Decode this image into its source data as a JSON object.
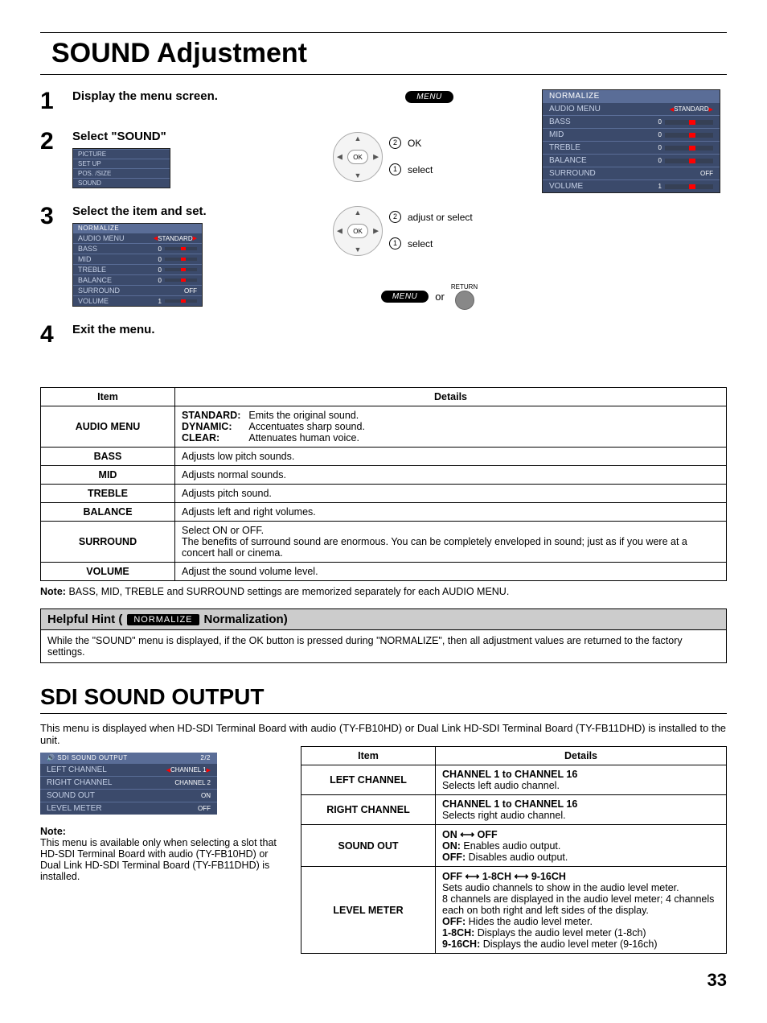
{
  "page": {
    "title": "SOUND Adjustment",
    "page_number": "33"
  },
  "steps": [
    {
      "num": "1",
      "title": "Display the menu screen."
    },
    {
      "num": "2",
      "title": "Select \"SOUND\""
    },
    {
      "num": "3",
      "title": "Select the item and set."
    },
    {
      "num": "4",
      "title": "Exit the menu."
    }
  ],
  "remote": {
    "menu_label": "MENU",
    "return_label": "RETURN",
    "ok_label": "OK",
    "or": "or",
    "labels": {
      "ok_action": "OK",
      "select": "select",
      "adjust": "adjust or select"
    }
  },
  "osd_small_menu": {
    "items": [
      "PICTURE",
      "SET UP",
      "POS. /SIZE",
      "SOUND"
    ]
  },
  "osd_sound": {
    "head": "NORMALIZE",
    "rows": [
      {
        "k": "AUDIO MENU",
        "v": "STANDARD",
        "type": "tri"
      },
      {
        "k": "BASS",
        "v": "0",
        "type": "bar"
      },
      {
        "k": "MID",
        "v": "0",
        "type": "bar"
      },
      {
        "k": "TREBLE",
        "v": "0",
        "type": "bar"
      },
      {
        "k": "BALANCE",
        "v": "0",
        "type": "bar"
      },
      {
        "k": "SURROUND",
        "v": "OFF",
        "type": "text"
      },
      {
        "k": "VOLUME",
        "v": "1",
        "type": "barv"
      }
    ]
  },
  "table1": {
    "headers": [
      "Item",
      "Details"
    ],
    "rows": [
      {
        "item": "AUDIO MENU",
        "html": [
          [
            "STANDARD:",
            "Emits the original sound."
          ],
          [
            "DYNAMIC:",
            "Accentuates sharp sound."
          ],
          [
            "CLEAR:",
            "Attenuates human voice."
          ]
        ]
      },
      {
        "item": "BASS",
        "text": "Adjusts low pitch sounds."
      },
      {
        "item": "MID",
        "text": "Adjusts normal sounds."
      },
      {
        "item": "TREBLE",
        "text": "Adjusts pitch sound."
      },
      {
        "item": "BALANCE",
        "text": "Adjusts left and right volumes."
      },
      {
        "item": "SURROUND",
        "text": "Select ON or OFF.\nThe benefits of surround sound are enormous. You can be completely enveloped in sound; just as if you were at a concert hall or cinema."
      },
      {
        "item": "VOLUME",
        "text": "Adjust the sound volume level."
      }
    ]
  },
  "note1": {
    "label": "Note:",
    "text": "BASS, MID, TREBLE and SURROUND settings are memorized separately for each AUDIO MENU."
  },
  "hint": {
    "prefix": "Helpful Hint (",
    "badge": "NORMALIZE",
    "suffix": " Normalization)",
    "body": "While the \"SOUND\" menu is displayed, if the OK button is pressed during \"NORMALIZE\", then all adjustment values are returned to the factory settings."
  },
  "sdi": {
    "title": "SDI SOUND OUTPUT",
    "intro": "This menu is displayed when HD-SDI Terminal Board with audio (TY-FB10HD) or Dual Link HD-SDI Terminal Board (TY-FB11DHD) is installed to the unit.",
    "note_label": "Note:",
    "note": "This menu is available only when selecting a slot that HD-SDI Terminal Board with audio (TY-FB10HD) or Dual Link HD-SDI Terminal Board (TY-FB11DHD) is installed.",
    "osd": {
      "head": "SDI SOUND OUTPUT",
      "page": "2/2",
      "rows": [
        {
          "k": "LEFT CHANNEL",
          "v": "CHANNEL 1"
        },
        {
          "k": "RIGHT CHANNEL",
          "v": "CHANNEL 2"
        },
        {
          "k": "SOUND OUT",
          "v": "ON"
        },
        {
          "k": "LEVEL METER",
          "v": "OFF"
        }
      ]
    },
    "table": {
      "headers": [
        "Item",
        "Details"
      ],
      "rows": [
        {
          "item": "LEFT CHANNEL",
          "bold": "CHANNEL 1 to CHANNEL 16",
          "text": "Selects left audio channel."
        },
        {
          "item": "RIGHT CHANNEL",
          "bold": "CHANNEL 1 to CHANNEL 16",
          "text": "Selects right audio channel."
        },
        {
          "item": "SOUND OUT",
          "arrow": "ON ⟷ OFF",
          "lines": [
            [
              "ON:",
              "Enables audio output."
            ],
            [
              "OFF:",
              "Disables audio output."
            ]
          ]
        },
        {
          "item": "LEVEL METER",
          "arrow": "OFF ⟷ 1-8CH ⟷ 9-16CH",
          "desc": "Sets audio channels to show in the audio level meter.\n8 channels are displayed in the audio level meter; 4 channels each on both right and left sides of the display.",
          "lines": [
            [
              "OFF:",
              "Hides the audio level meter."
            ],
            [
              "1-8CH:",
              "Displays the audio level meter (1-8ch)"
            ],
            [
              "9-16CH:",
              "Displays the audio level meter (9-16ch)"
            ]
          ]
        }
      ]
    }
  }
}
